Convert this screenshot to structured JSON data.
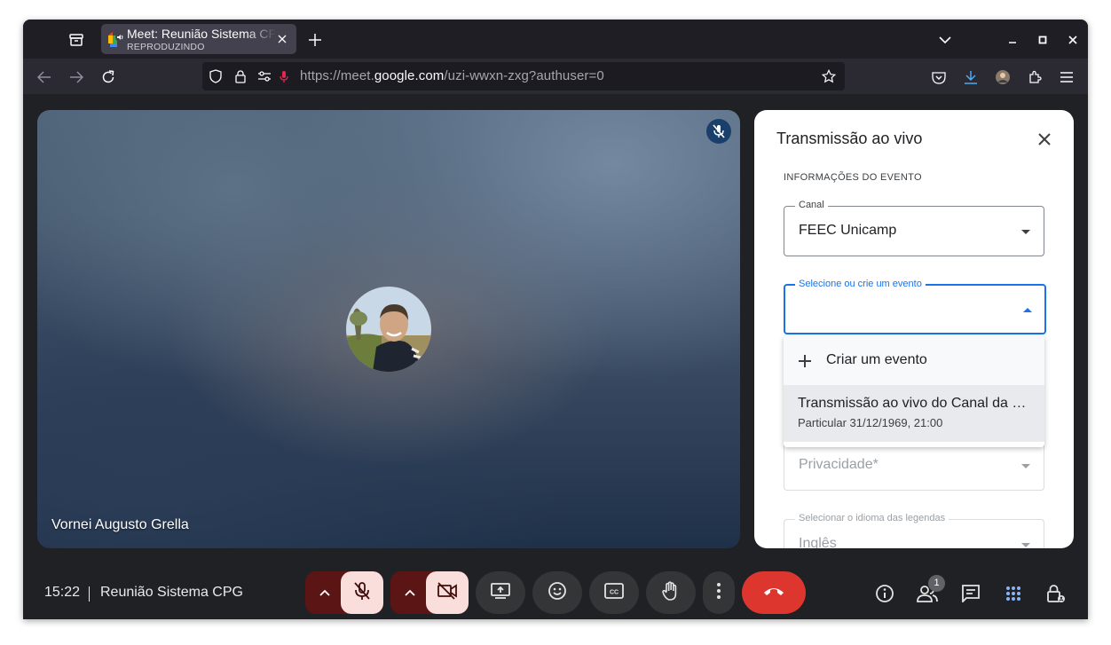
{
  "browser": {
    "tab": {
      "title": "Meet: Reunião Sistema CPG",
      "status": "REPRODUZINDO"
    },
    "url": {
      "prefix": "https://meet.",
      "host": "google.com",
      "path": "/uzi-wwxn-zxg?authuser=0"
    }
  },
  "video": {
    "participant_name": "Vornei Augusto Grella"
  },
  "panel": {
    "title": "Transmissão ao vivo",
    "section_label": "INFORMAÇÕES DO EVENTO",
    "channel_label": "Canal",
    "channel_value": "FEEC Unicamp",
    "event_label": "Selecione ou crie um evento",
    "dropdown": {
      "create_label": "Criar um evento",
      "option_title": "Transmissão ao vivo do Canal da FEEC",
      "option_subtitle": "Particular 31/12/1969, 21:00"
    },
    "privacy_placeholder": "Privacidade*",
    "caption_lang_label": "Selecionar o idioma das legendas",
    "caption_lang_value": "Inglês"
  },
  "bottombar": {
    "time": "15:22",
    "meeting_name": "Reunião Sistema CPG",
    "participants_count": "1"
  },
  "colors": {
    "hangup": "#dc362e",
    "accent": "#1a73e8",
    "muted_bg": "#f9dedc"
  }
}
